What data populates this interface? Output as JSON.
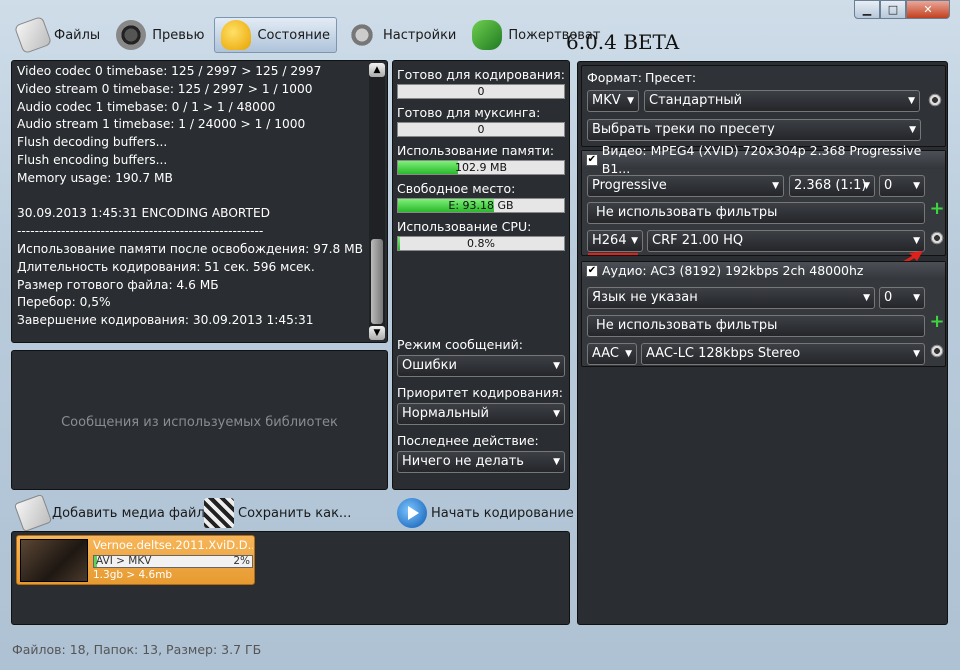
{
  "window": {
    "min": "▁",
    "max": "□",
    "close": "✕"
  },
  "toolbar": {
    "files": "Файлы",
    "preview": "Превью",
    "status": "Состояние",
    "settings": "Настройки",
    "donate": "Пожертвоват",
    "version": "6.0.4 BETA"
  },
  "log": {
    "text": "Video codec 0 timebase: 125 / 2997 > 125 / 2997\nVideo stream 0 timebase: 125 / 2997 > 1 / 1000\nAudio codec 1 timebase: 0 / 1 > 1 / 48000\nAudio stream 1 timebase: 1 / 24000 > 1 / 1000\nFlush decoding buffers...\nFlush encoding buffers...\nMemory usage: 190.7 MB\n\n30.09.2013 1:45:31 ENCODING ABORTED\n--------------------------------------------------------\nИспользование памяти после освобождения: 97.8 MB\nДлительность кодирования: 51 сек. 596 мсек.\nРазмер готового файла: 4.6 МБ\nПеребор: 0,5%\nЗавершение кодирования: 30.09.2013 1:45:31"
  },
  "libs": {
    "placeholder": "Сообщения из используемых библиотек"
  },
  "stats": {
    "ready_encode_label": "Готово для кодирования:",
    "ready_encode_value": "0",
    "ready_mux_label": "Готово для муксинга:",
    "ready_mux_value": "0",
    "memory_label": "Использование памяти:",
    "memory_value": "102.9 MB",
    "memory_fill": 0.36,
    "free_label": "Свободное место:",
    "free_value": "E: 93.18 GB",
    "free_fill": 0.58,
    "cpu_label": "Использование CPU:",
    "cpu_value": "0.8%",
    "cpu_fill": 0.01,
    "msg_mode_label": "Режим сообщений:",
    "msg_mode_value": "Ошибки",
    "priority_label": "Приоритет кодирования:",
    "priority_value": "Нормальный",
    "last_action_label": "Последнее действие:",
    "last_action_value": "Ничего не делать"
  },
  "actions": {
    "add": "Добавить медиа файл",
    "save": "Сохранить как...",
    "start": "Начать кодирование"
  },
  "queue": {
    "name": "Vernoe.deltse.2011.XviD.D...",
    "conversion": "AVI > MKV",
    "percent": "2%",
    "progress": 0.02,
    "size": "1.3gb > 4.6mb"
  },
  "format": {
    "format_label": "Формат:",
    "preset_label": "Пресет:",
    "container": "MKV",
    "preset": "Стандартный",
    "select_tracks": "Выбрать треки по пресету"
  },
  "video": {
    "title": "Видео: MPEG4 (XVID) 720x304p 2.368 Progressive B1...",
    "scan": "Progressive",
    "aspect": "2.368 (1:1)",
    "index": "0",
    "filters": "Не использовать фильтры",
    "codec": "H264",
    "codec_preset": "CRF 21.00 HQ"
  },
  "audio": {
    "title": "Аудио: AC3 (8192) 192kbps 2ch 48000hz",
    "language": "Язык не указан",
    "index": "0",
    "filters": "Не использовать фильтры",
    "codec": "AAC",
    "codec_preset": "AAC-LC 128kbps Stereo"
  },
  "statusbar": {
    "text": "Файлов: 18, Папок: 13, Размер: 3.7 ГБ"
  },
  "colors": {
    "accent_green": "#2ab82a",
    "annotation_red": "#e0201a"
  }
}
